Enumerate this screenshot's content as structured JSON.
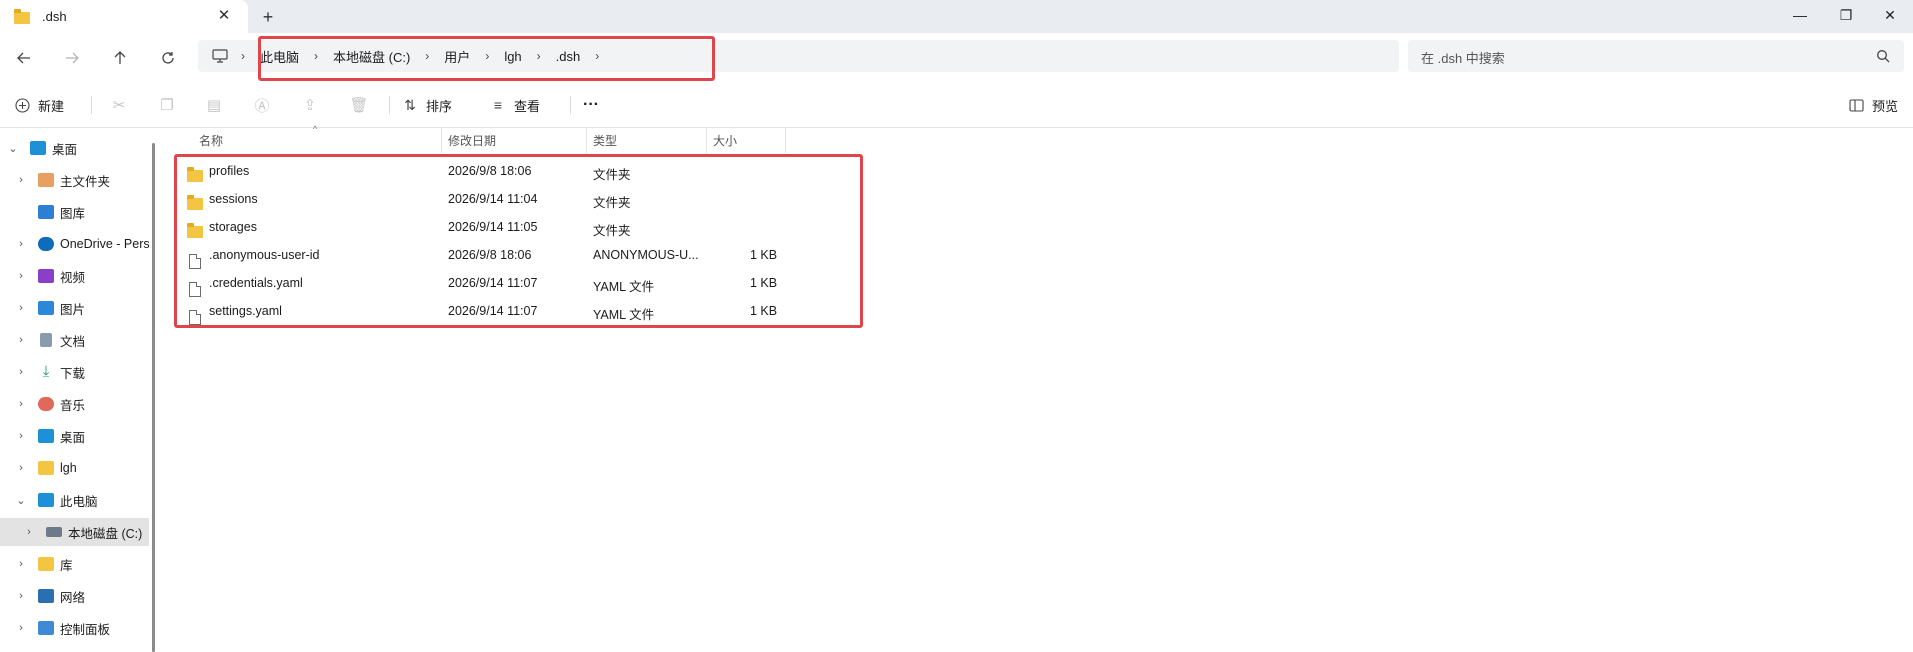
{
  "window": {
    "tab_title": ".dsh",
    "new_tab_label": "+",
    "minimize_label": "—",
    "restore_label": "❐",
    "close_label": "✕"
  },
  "address": {
    "crumbs": [
      "此电脑",
      "本地磁盘 (C:)",
      "用户",
      "lgh",
      ".dsh"
    ],
    "search_placeholder": "在 .dsh 中搜索"
  },
  "toolbar": {
    "new_label": "新建",
    "sort_label": "排序",
    "view_label": "查看",
    "more_label": "···",
    "preview_label": "预览"
  },
  "sidebar": {
    "items": [
      {
        "label": "桌面",
        "icon": "desktop-icon"
      },
      {
        "label": "主文件夹",
        "icon": "home-icon"
      },
      {
        "label": "图库",
        "icon": "gallery-icon"
      },
      {
        "label": "OneDrive - Pers",
        "icon": "onedrive-icon"
      },
      {
        "label": "视频",
        "icon": "videos-icon"
      },
      {
        "label": "图片",
        "icon": "pictures-icon"
      },
      {
        "label": "文档",
        "icon": "documents-icon"
      },
      {
        "label": "下载",
        "icon": "downloads-icon"
      },
      {
        "label": "音乐",
        "icon": "music-icon"
      },
      {
        "label": "桌面",
        "icon": "desktop-icon"
      },
      {
        "label": "lgh",
        "icon": "folder-icon"
      },
      {
        "label": "此电脑",
        "icon": "this-pc-icon"
      },
      {
        "label": "本地磁盘 (C:)",
        "icon": "drive-icon"
      },
      {
        "label": "库",
        "icon": "library-icon"
      },
      {
        "label": "网络",
        "icon": "network-icon"
      },
      {
        "label": "控制面板",
        "icon": "control-panel-icon"
      }
    ]
  },
  "columns": {
    "name": "名称",
    "modified": "修改日期",
    "type": "类型",
    "size": "大小"
  },
  "files": [
    {
      "name": "profiles",
      "modified": "2026/9/8 18:06",
      "type": "文件夹",
      "size": "",
      "kind": "folder"
    },
    {
      "name": "sessions",
      "modified": "2026/9/14 11:04",
      "type": "文件夹",
      "size": "",
      "kind": "folder"
    },
    {
      "name": "storages",
      "modified": "2026/9/14 11:05",
      "type": "文件夹",
      "size": "",
      "kind": "folder"
    },
    {
      "name": ".anonymous-user-id",
      "modified": "2026/9/8 18:06",
      "type": "ANONYMOUS-U...",
      "size": "1 KB",
      "kind": "file"
    },
    {
      "name": ".credentials.yaml",
      "modified": "2026/9/14 11:07",
      "type": "YAML 文件",
      "size": "1 KB",
      "kind": "file"
    },
    {
      "name": "settings.yaml",
      "modified": "2026/9/14 11:07",
      "type": "YAML 文件",
      "size": "1 KB",
      "kind": "file"
    }
  ],
  "colors": {
    "highlight": "#e0454b",
    "folder": "#f4c542",
    "selected_bg": "#e3e3e3"
  }
}
